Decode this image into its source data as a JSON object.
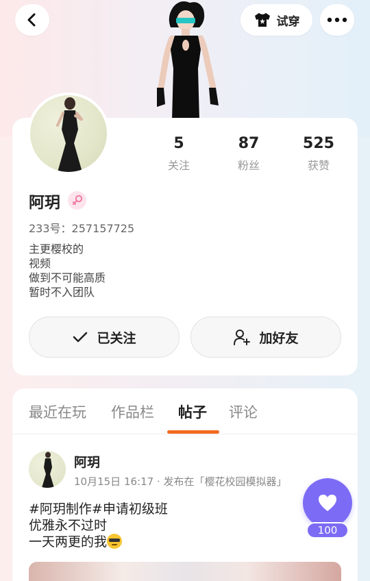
{
  "topbar": {
    "try_on_label": "试穿"
  },
  "profile": {
    "nickname": "阿玥",
    "uid": "233号：257157725",
    "bio_lines": [
      "主更樱校的",
      "视频",
      "做到不可能高质",
      "暂时不入团队"
    ],
    "stats": [
      {
        "value": "5",
        "label": "关注"
      },
      {
        "value": "87",
        "label": "粉丝"
      },
      {
        "value": "525",
        "label": "获赞"
      }
    ],
    "followed_label": "已关注",
    "add_friend_label": "加好友"
  },
  "tabs": [
    {
      "label": "最近在玩",
      "active": false
    },
    {
      "label": "作品栏",
      "active": false
    },
    {
      "label": "帖子",
      "active": true
    },
    {
      "label": "评论",
      "active": false
    }
  ],
  "post": {
    "author": "阿玥",
    "meta": "10月15日 16:17 · 发布在「樱花校园模拟器」",
    "lines": [
      "#阿玥制作#申请初级班",
      "优雅永不过时",
      "一天两更的我"
    ],
    "emoji": "sunglasses-emoji",
    "like_count": "100"
  },
  "colors": {
    "accent_tab": "#f36b1f",
    "like_button": "#7c6cf5"
  }
}
